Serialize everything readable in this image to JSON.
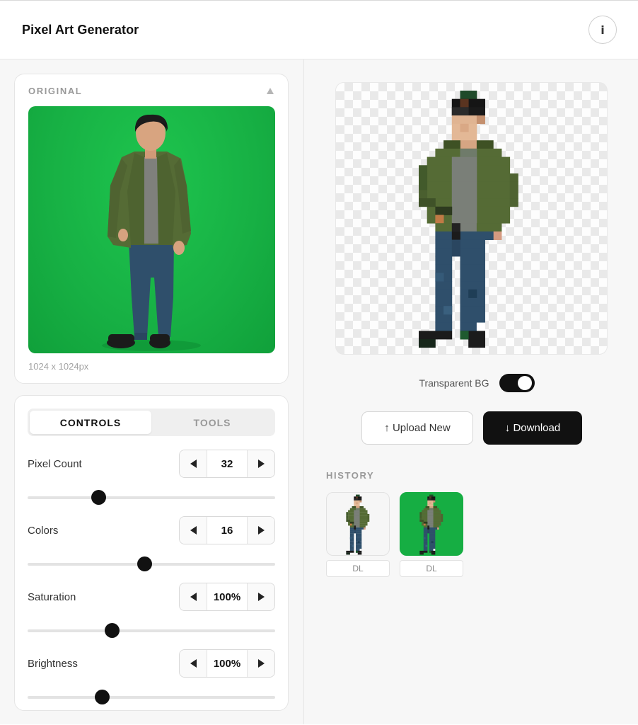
{
  "app": {
    "title": "Pixel Art Generator",
    "info_label": "i"
  },
  "original": {
    "label": "ORIGINAL",
    "dimensions": "1024 x 1024px",
    "colors": {
      "background": "#17b044",
      "jacket": "#556b35",
      "jeans": "#2f4f6b",
      "shirt": "#808080"
    }
  },
  "tabs": [
    {
      "label": "CONTROLS",
      "active": true
    },
    {
      "label": "TOOLS",
      "active": false
    }
  ],
  "controls": [
    {
      "label": "Pixel Count",
      "value": "32",
      "level": 0.285
    },
    {
      "label": "Colors",
      "value": "16",
      "level": 0.47
    },
    {
      "label": "Saturation",
      "value": "100%",
      "level": 0.34
    },
    {
      "label": "Brightness",
      "value": "100%",
      "level": 0.3
    }
  ],
  "preview": {
    "transparent_bg": true
  },
  "toggle": {
    "label": "Transparent BG",
    "on": true
  },
  "actions": {
    "upload_label": "↑ Upload New",
    "download_label": "↓ Download"
  },
  "history": {
    "label": "HISTORY",
    "items": [
      {
        "dl_label": "DL",
        "background": "transparent"
      },
      {
        "dl_label": "DL",
        "background": "#16ae43"
      }
    ]
  },
  "icons": {
    "info": "info-icon",
    "collapse": "chevron-up-icon",
    "step_left": "triangle-left-icon",
    "step_right": "triangle-right-icon"
  }
}
